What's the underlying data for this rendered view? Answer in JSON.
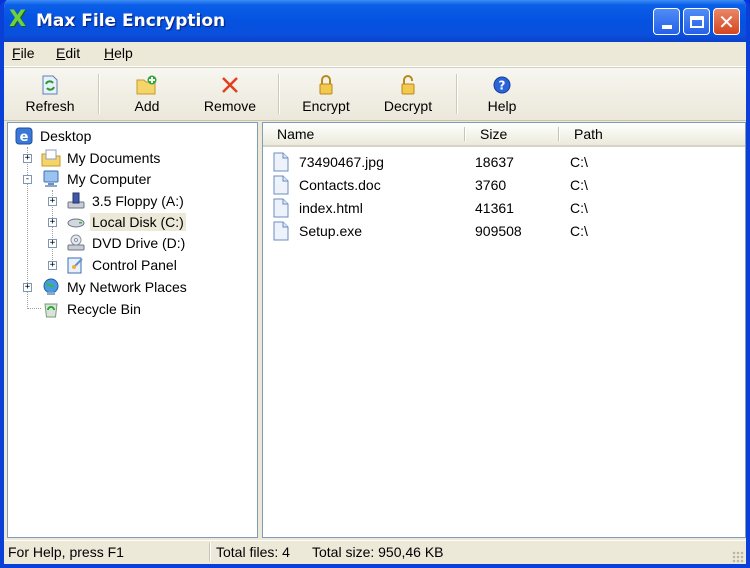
{
  "window": {
    "title": "Max File Encryption",
    "app_icon": "green-x-icon",
    "controls": {
      "minimize": "minimize",
      "maximize": "maximize",
      "close": "close"
    }
  },
  "menu": [
    {
      "label": "File",
      "mnemonic": "F"
    },
    {
      "label": "Edit",
      "mnemonic": "E"
    },
    {
      "label": "Help",
      "mnemonic": "H"
    }
  ],
  "toolbar": {
    "refresh": {
      "label": "Refresh",
      "icon": "refresh-icon"
    },
    "add": {
      "label": "Add",
      "icon": "add-folder-icon"
    },
    "remove": {
      "label": "Remove",
      "icon": "remove-x-icon"
    },
    "encrypt": {
      "label": "Encrypt",
      "icon": "lock-closed-icon"
    },
    "decrypt": {
      "label": "Decrypt",
      "icon": "lock-open-icon"
    },
    "help": {
      "label": "Help",
      "icon": "help-question-icon"
    }
  },
  "tree": [
    {
      "label": "Desktop",
      "icon": "desktop-icon",
      "level": 0,
      "expander": "",
      "selected": false
    },
    {
      "label": "My Documents",
      "icon": "my-documents-icon",
      "level": 1,
      "expander": "+",
      "selected": false
    },
    {
      "label": "My Computer",
      "icon": "my-computer-icon",
      "level": 1,
      "expander": "-",
      "selected": false
    },
    {
      "label": "3.5 Floppy (A:)",
      "icon": "floppy-drive-icon",
      "level": 2,
      "expander": "+",
      "selected": false
    },
    {
      "label": "Local Disk (C:)",
      "icon": "hard-disk-icon",
      "level": 2,
      "expander": "+",
      "selected": true
    },
    {
      "label": "DVD Drive (D:)",
      "icon": "dvd-drive-icon",
      "level": 2,
      "expander": "+",
      "selected": false
    },
    {
      "label": "Control Panel",
      "icon": "control-panel-icon",
      "level": 2,
      "expander": "+",
      "selected": false
    },
    {
      "label": "My Network Places",
      "icon": "network-places-icon",
      "level": 1,
      "expander": "+",
      "selected": false
    },
    {
      "label": "Recycle Bin",
      "icon": "recycle-bin-icon",
      "level": 1,
      "expander": "",
      "selected": false
    }
  ],
  "list": {
    "columns": [
      "Name",
      "Size",
      "Path"
    ],
    "rows": [
      {
        "name": "73490467.jpg",
        "size": "18637",
        "path": "C:\\"
      },
      {
        "name": "Contacts.doc",
        "size": "3760",
        "path": "C:\\"
      },
      {
        "name": "index.html",
        "size": "41361",
        "path": "C:\\"
      },
      {
        "name": "Setup.exe",
        "size": "909508",
        "path": "C:\\"
      }
    ]
  },
  "status": {
    "help": "For Help, press F1",
    "total_files": "Total files: 4",
    "total_size": "Total size: 950,46 KB"
  }
}
